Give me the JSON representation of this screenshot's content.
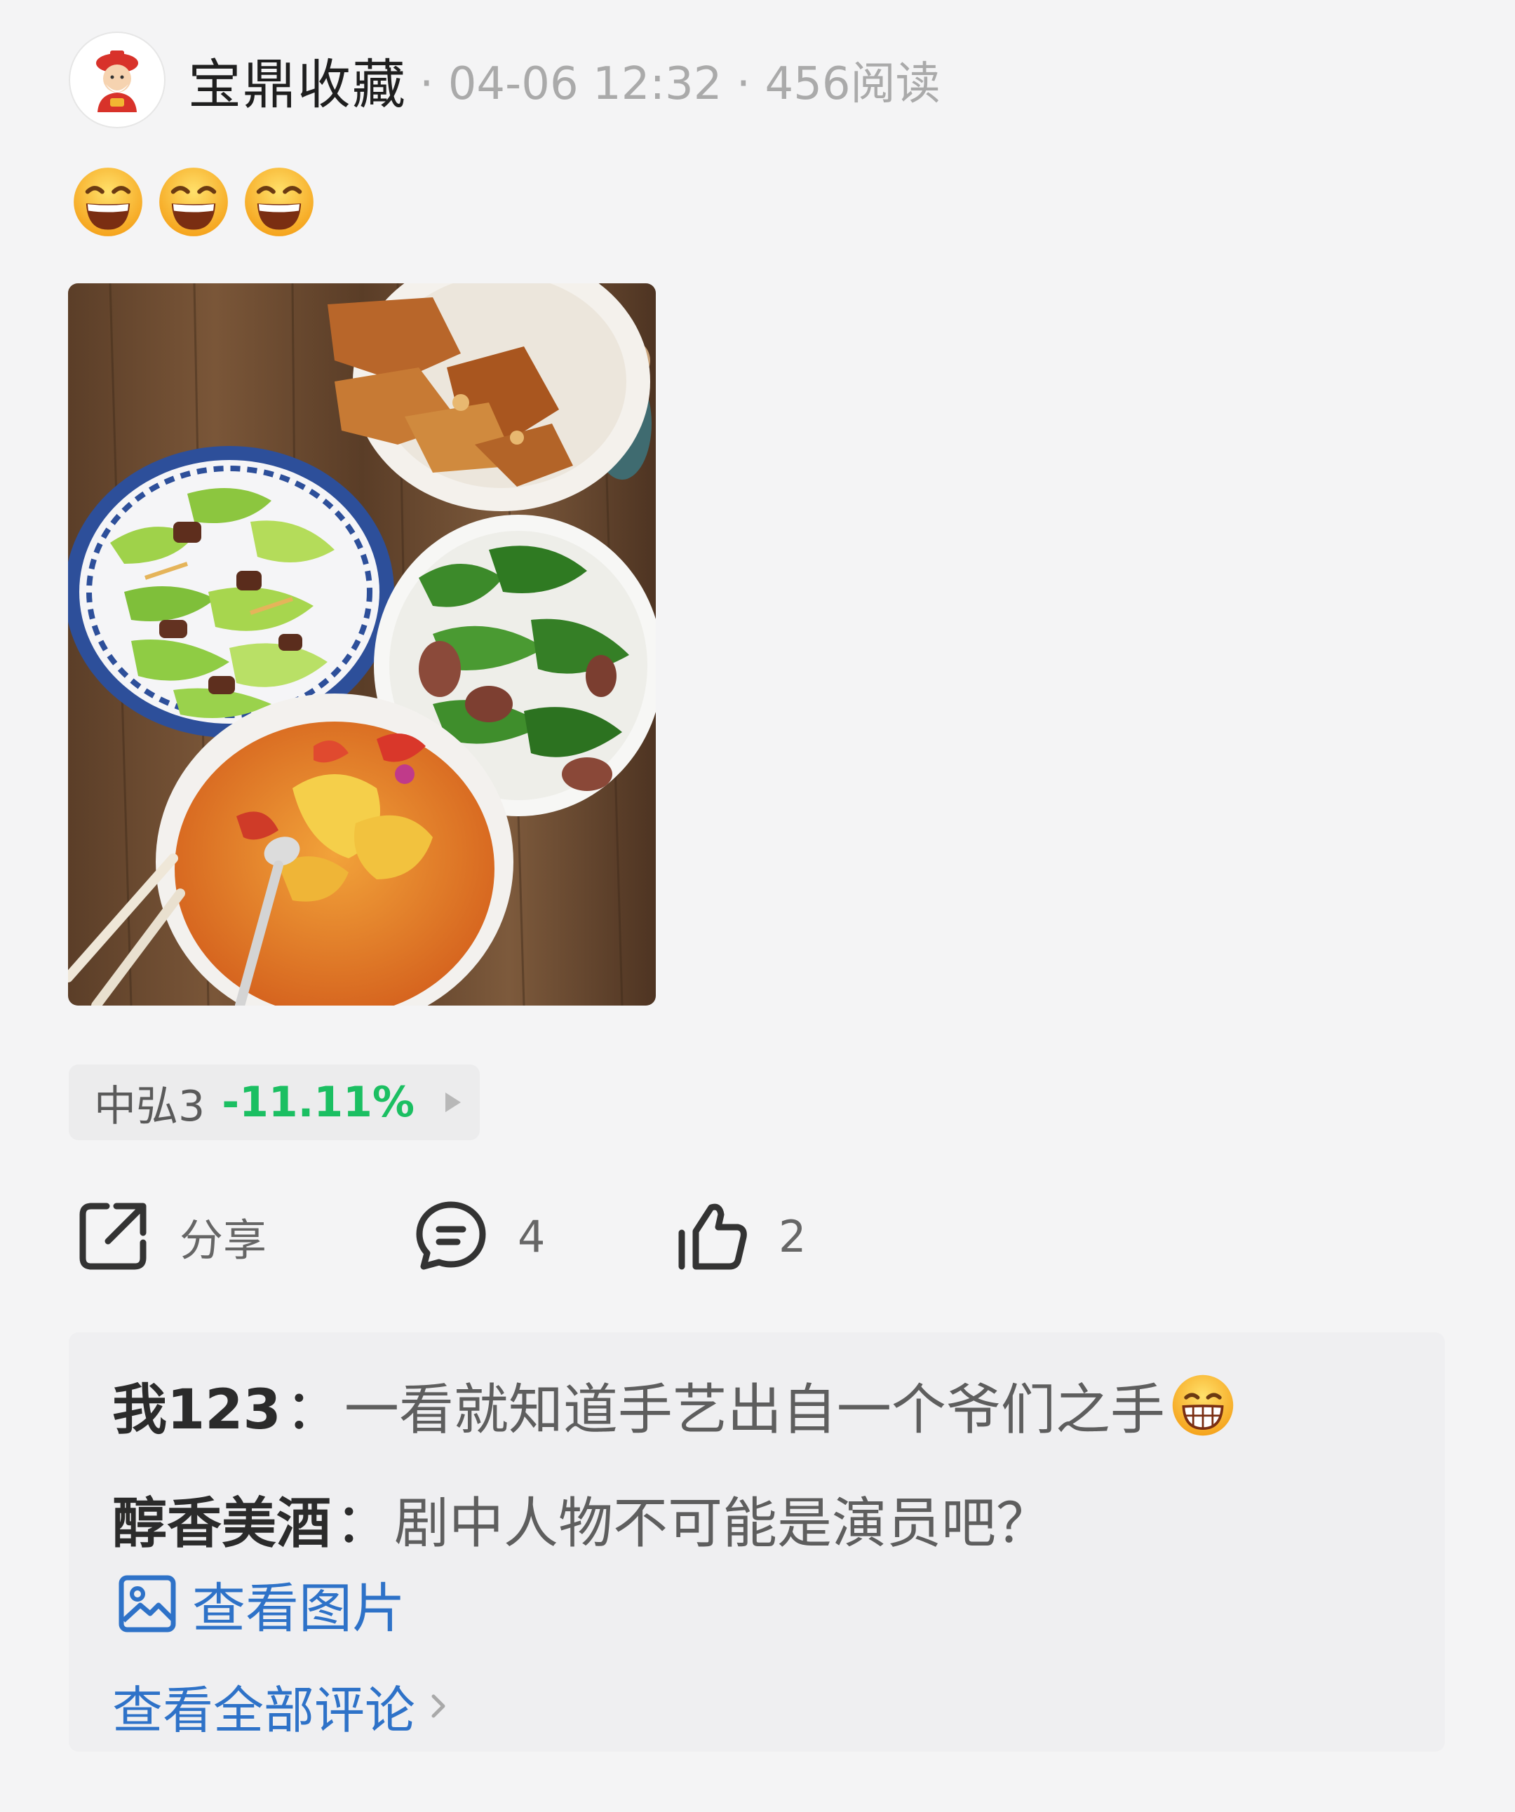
{
  "post": {
    "author": "宝鼎收藏",
    "meta": "· 04-06 12:32 · 456阅读",
    "emojis": [
      "grinning-emoji",
      "grinning-emoji",
      "grinning-emoji"
    ],
    "image": "home-cooked-dishes-photo"
  },
  "stock_tag": {
    "name": "中弘3",
    "change": "-11.11%",
    "change_color": "#1bbf62"
  },
  "actions": {
    "share_label": "分享",
    "comment_count": "4",
    "like_count": "2"
  },
  "comments": [
    {
      "user": "我123",
      "sep": "：",
      "text": "一看就知道手艺出自一个爷们之手",
      "emoji": "grin-emoji"
    },
    {
      "user": "醇香美酒",
      "sep": "：",
      "text": "剧中人物不可能是演员吧？"
    }
  ],
  "view_image_label": "查看图片",
  "view_all_label": "查看全部评论",
  "colors": {
    "link": "#2e72c8",
    "background": "#f4f4f5",
    "comment_bg": "#efeff1"
  }
}
